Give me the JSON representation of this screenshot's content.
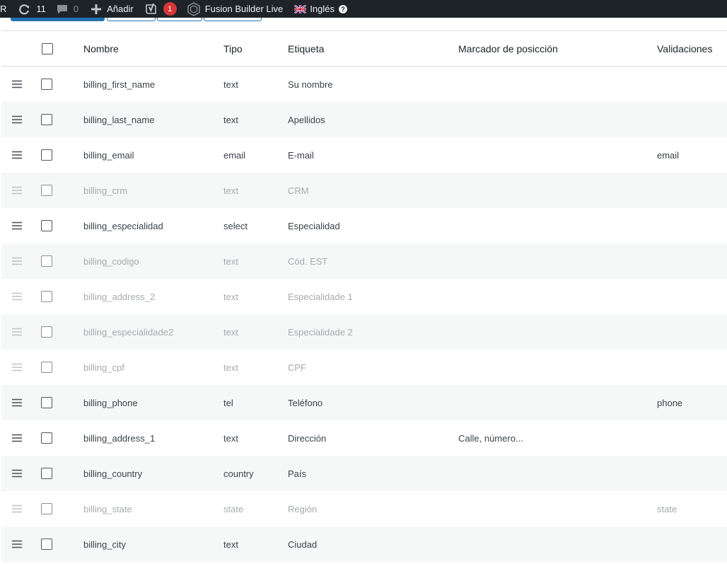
{
  "adminbar": {
    "logo_fragment": "R",
    "updates_count": "11",
    "comments_count": "0",
    "new_label": "Añadir",
    "yoast_badge": "1",
    "fusion_label": "Fusion Builder Live",
    "language_label": "Inglés"
  },
  "table": {
    "headers": {
      "name": "Nombre",
      "type": "Tipo",
      "label": "Etiqueta",
      "placeholder": "Marcador de posicción",
      "validations": "Validaciones"
    },
    "rows": [
      {
        "name": "billing_first_name",
        "type": "text",
        "label": "Su nombre",
        "placeholder": "",
        "validations": "",
        "disabled": false
      },
      {
        "name": "billing_last_name",
        "type": "text",
        "label": "Apellidos",
        "placeholder": "",
        "validations": "",
        "disabled": false
      },
      {
        "name": "billing_email",
        "type": "email",
        "label": "E-mail",
        "placeholder": "",
        "validations": "email",
        "disabled": false
      },
      {
        "name": "billing_crm",
        "type": "text",
        "label": "CRM",
        "placeholder": "",
        "validations": "",
        "disabled": true
      },
      {
        "name": "billing_especialidad",
        "type": "select",
        "label": "Especialidad",
        "placeholder": "",
        "validations": "",
        "disabled": false
      },
      {
        "name": "billing_codigo",
        "type": "text",
        "label": "Cód. EST",
        "placeholder": "",
        "validations": "",
        "disabled": true
      },
      {
        "name": "billing_address_2",
        "type": "text",
        "label": "Especialidade 1",
        "placeholder": "",
        "validations": "",
        "disabled": true
      },
      {
        "name": "billing_especialidade2",
        "type": "text",
        "label": "Especialidade 2",
        "placeholder": "",
        "validations": "",
        "disabled": true
      },
      {
        "name": "billing_cpf",
        "type": "text",
        "label": "CPF",
        "placeholder": "",
        "validations": "",
        "disabled": true
      },
      {
        "name": "billing_phone",
        "type": "tel",
        "label": "Teléfono",
        "placeholder": "",
        "validations": "phone",
        "disabled": false
      },
      {
        "name": "billing_address_1",
        "type": "text",
        "label": "Dirección",
        "placeholder": "Calle, número...",
        "validations": "",
        "disabled": false
      },
      {
        "name": "billing_country",
        "type": "country",
        "label": "País",
        "placeholder": "",
        "validations": "",
        "disabled": false
      },
      {
        "name": "billing_state",
        "type": "state",
        "label": "Región",
        "placeholder": "",
        "validations": "state",
        "disabled": true
      },
      {
        "name": "billing_city",
        "type": "text",
        "label": "Ciudad",
        "placeholder": "",
        "validations": "",
        "disabled": false
      }
    ]
  },
  "colors": {
    "adminbar_bg": "#1d2327",
    "accent": "#2271b1",
    "badge": "#d63638",
    "alt_row": "#f6f7f7",
    "disabled_text": "#a7aaad"
  },
  "icons": {
    "updates": "refresh-icon",
    "comments": "comment-icon",
    "new": "plus-icon",
    "yoast": "yoast-icon",
    "fusion": "fusion-logo-icon",
    "flag": "uk-flag-icon",
    "help": "help-icon",
    "drag": "drag-handle-icon"
  }
}
